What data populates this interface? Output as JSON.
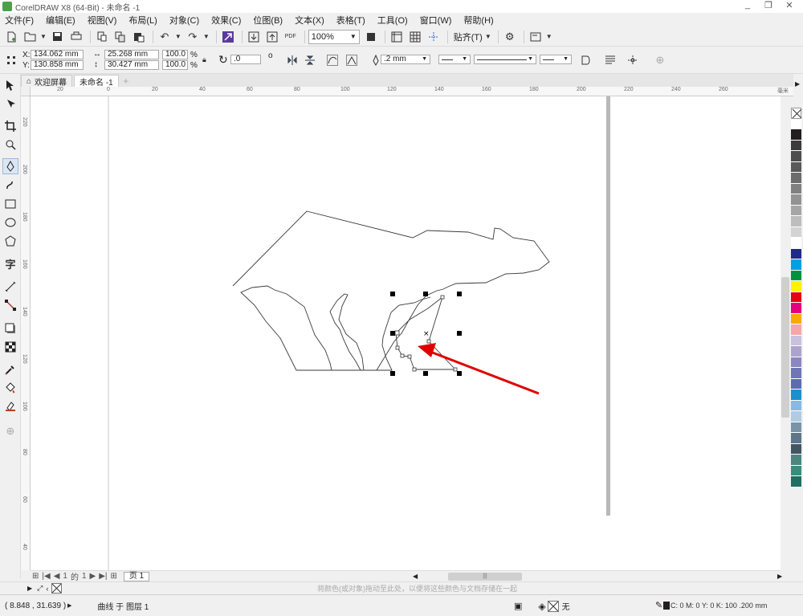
{
  "window": {
    "title": "CorelDRAW X8 (64-Bit) - 未命名 -1",
    "controls": [
      "_",
      "❐",
      "✕"
    ]
  },
  "menu": [
    "文件(F)",
    "编辑(E)",
    "视图(V)",
    "布局(L)",
    "对象(C)",
    "效果(C)",
    "位图(B)",
    "文本(X)",
    "表格(T)",
    "工具(O)",
    "窗口(W)",
    "帮助(H)"
  ],
  "standard_toolbar": {
    "zoom": "100%",
    "snap_label": "贴齐(T)"
  },
  "property_bar": {
    "x": "134.062 mm",
    "y": "130.858 mm",
    "width": "25.268 mm",
    "height": "30.427 mm",
    "scale_x": "100.0",
    "scale_y": "100.0",
    "percent": "%",
    "rotation": ".0",
    "degree": "o",
    "outline_width": ".2 mm"
  },
  "tabs": {
    "welcome": "欢迎屏幕",
    "document": "未命名 -1"
  },
  "ruler_h_labels": [
    "20",
    "0",
    "20",
    "40",
    "60",
    "80",
    "100",
    "120",
    "140",
    "160",
    "180",
    "200",
    "220",
    "240",
    "260",
    "毫米"
  ],
  "ruler_v_labels": [
    "220",
    "200",
    "180",
    "160",
    "140",
    "120",
    "100",
    "80",
    "60",
    "40",
    "20",
    "0"
  ],
  "page_nav": {
    "current": "1",
    "of": "的",
    "total": "1",
    "page_tab": "页 1"
  },
  "color_bar": {
    "hint": "将颜色(或对象)拖动至此处，以便将这些颜色与文档存储在一起"
  },
  "status": {
    "cursor": "( 8.848 , 31.639 )",
    "object_info": "曲线 于 图层 1",
    "fill": "无",
    "outline_info": "C: 0 M: 0 Y: 0 K: 100 .200 mm"
  },
  "palette": [
    "#ffffff",
    "#231f20",
    "#3c3c3c",
    "#4d4d4d",
    "#595959",
    "#6d6d6d",
    "#808080",
    "#939393",
    "#a6a6a6",
    "#bdbdbd",
    "#d3d3d3",
    "#ffffff",
    "#1e2b87",
    "#00a0e3",
    "#00923f",
    "#fff100",
    "#e60012",
    "#e4007f",
    "#f7ab00",
    "#f6a5a8",
    "#c9c1dd",
    "#ada4cd",
    "#8b87bf",
    "#6f75b5",
    "#5b6db0",
    "#1c8fcf",
    "#86b9e4",
    "#b1cbe2",
    "#7894a6",
    "#5c7789",
    "#435561",
    "#4d867e",
    "#3c8c7e",
    "#1f6f63"
  ],
  "colors": {
    "accent_arrow": "#e00000",
    "handle": "#000000",
    "outline": "#3a3a3a"
  }
}
